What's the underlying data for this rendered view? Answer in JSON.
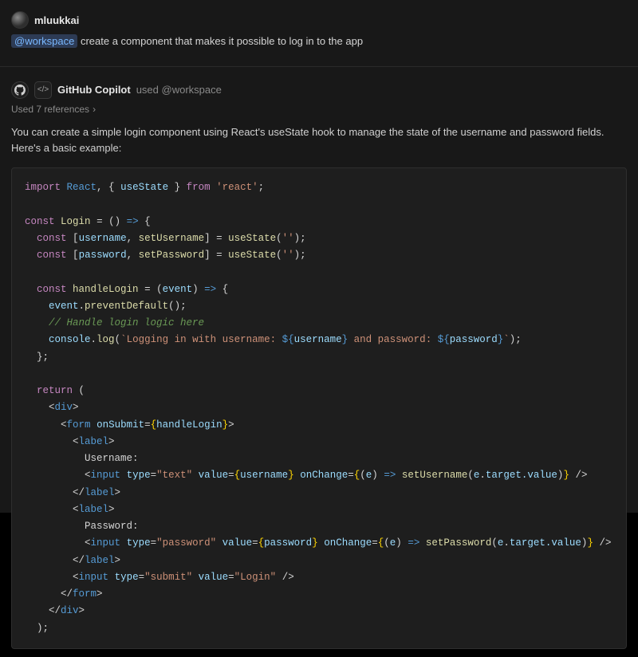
{
  "user": {
    "name": "mluukkai",
    "prompt_mention": "@workspace",
    "prompt_text": "create a component that makes it possible to log in to the app"
  },
  "copilot": {
    "name": "GitHub Copilot",
    "used_prefix": "used",
    "used_mention": "@workspace",
    "references_label": "Used 7 references",
    "explanation": "You can create a simple login component using React's useState hook to manage the state of the username and password fields. Here's a basic example:"
  },
  "chart_data": null,
  "code": {
    "t_import": "import",
    "t_from": "from",
    "t_const": "const",
    "t_return": "return",
    "v_react": "React",
    "v_usestate": "useState",
    "s_react_pkg": "'react'",
    "v_login": "Login",
    "v_username": "username",
    "v_setUsername": "setUsername",
    "v_password": "password",
    "v_setPassword": "setPassword",
    "s_empty": "''",
    "v_handleLogin": "handleLogin",
    "v_event": "event",
    "v_preventDefault": "preventDefault",
    "c_login_logic": "// Handle login logic here",
    "v_console": "console",
    "v_log": "log",
    "s_tpl_open": "`Logging in with username: ",
    "s_tpl_mid": " and password: ",
    "s_tpl_close": "`",
    "jsx_div": "div",
    "jsx_form": "form",
    "jsx_label": "label",
    "jsx_input": "input",
    "attr_onSubmit": "onSubmit",
    "attr_type": "type",
    "attr_value": "value",
    "attr_onChange": "onChange",
    "s_text": "\"text\"",
    "s_password": "\"password\"",
    "s_submit": "\"submit\"",
    "s_login": "\"Login\"",
    "txt_username": "Username:",
    "txt_password": "Password:",
    "v_e": "e",
    "v_target_value": "target.value"
  }
}
